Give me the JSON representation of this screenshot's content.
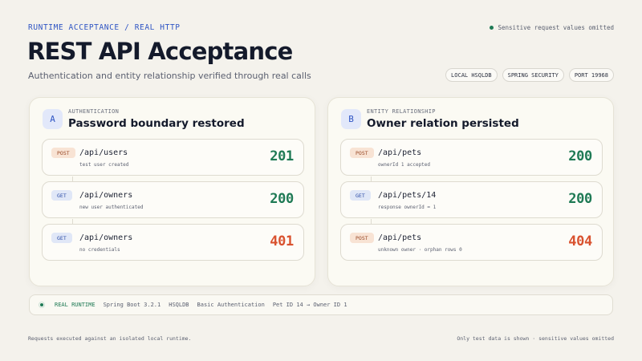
{
  "header": {
    "eyebrow": "RUNTIME ACCEPTANCE / REAL HTTP",
    "sensitive_note": "Sensitive request values omitted",
    "title": "REST API Acceptance",
    "subtitle": "Authentication and entity relationship verified through real calls"
  },
  "chips": [
    "LOCAL HSQLDB",
    "SPRING SECURITY",
    "PORT 19968"
  ],
  "panels": [
    {
      "badge": "A",
      "label": "AUTHENTICATION",
      "title": "Password boundary restored",
      "rows": [
        {
          "method": "POST",
          "path": "/api/users",
          "note": "test user created",
          "status": "201"
        },
        {
          "method": "GET",
          "path": "/api/owners",
          "note": "new user authenticated",
          "status": "200"
        },
        {
          "method": "GET",
          "path": "/api/owners",
          "note": "no credentials",
          "status": "401"
        }
      ]
    },
    {
      "badge": "B",
      "label": "ENTITY RELATIONSHIP",
      "title": "Owner relation persisted",
      "rows": [
        {
          "method": "POST",
          "path": "/api/pets",
          "note": "ownerId 1 accepted",
          "status": "200"
        },
        {
          "method": "GET",
          "path": "/api/pets/14",
          "note": "response ownerId = 1",
          "status": "200"
        },
        {
          "method": "POST",
          "path": "/api/pets",
          "note": "unknown owner · orphan rows 0",
          "status": "404"
        }
      ]
    }
  ],
  "footer_bar": {
    "runtime": "REAL RUNTIME",
    "items": [
      "Spring Boot 3.2.1",
      "HSQLDB",
      "Basic Authentication",
      "Pet ID 14 → Owner ID 1"
    ]
  },
  "footer": {
    "left": "Requests executed against an isolated local runtime.",
    "right": "Only test data is shown · sensitive values omitted"
  },
  "colors": {
    "accent": "#2f55c4",
    "success": "#1f7a55",
    "error": "#d9522f",
    "background": "#f4f2ec"
  }
}
